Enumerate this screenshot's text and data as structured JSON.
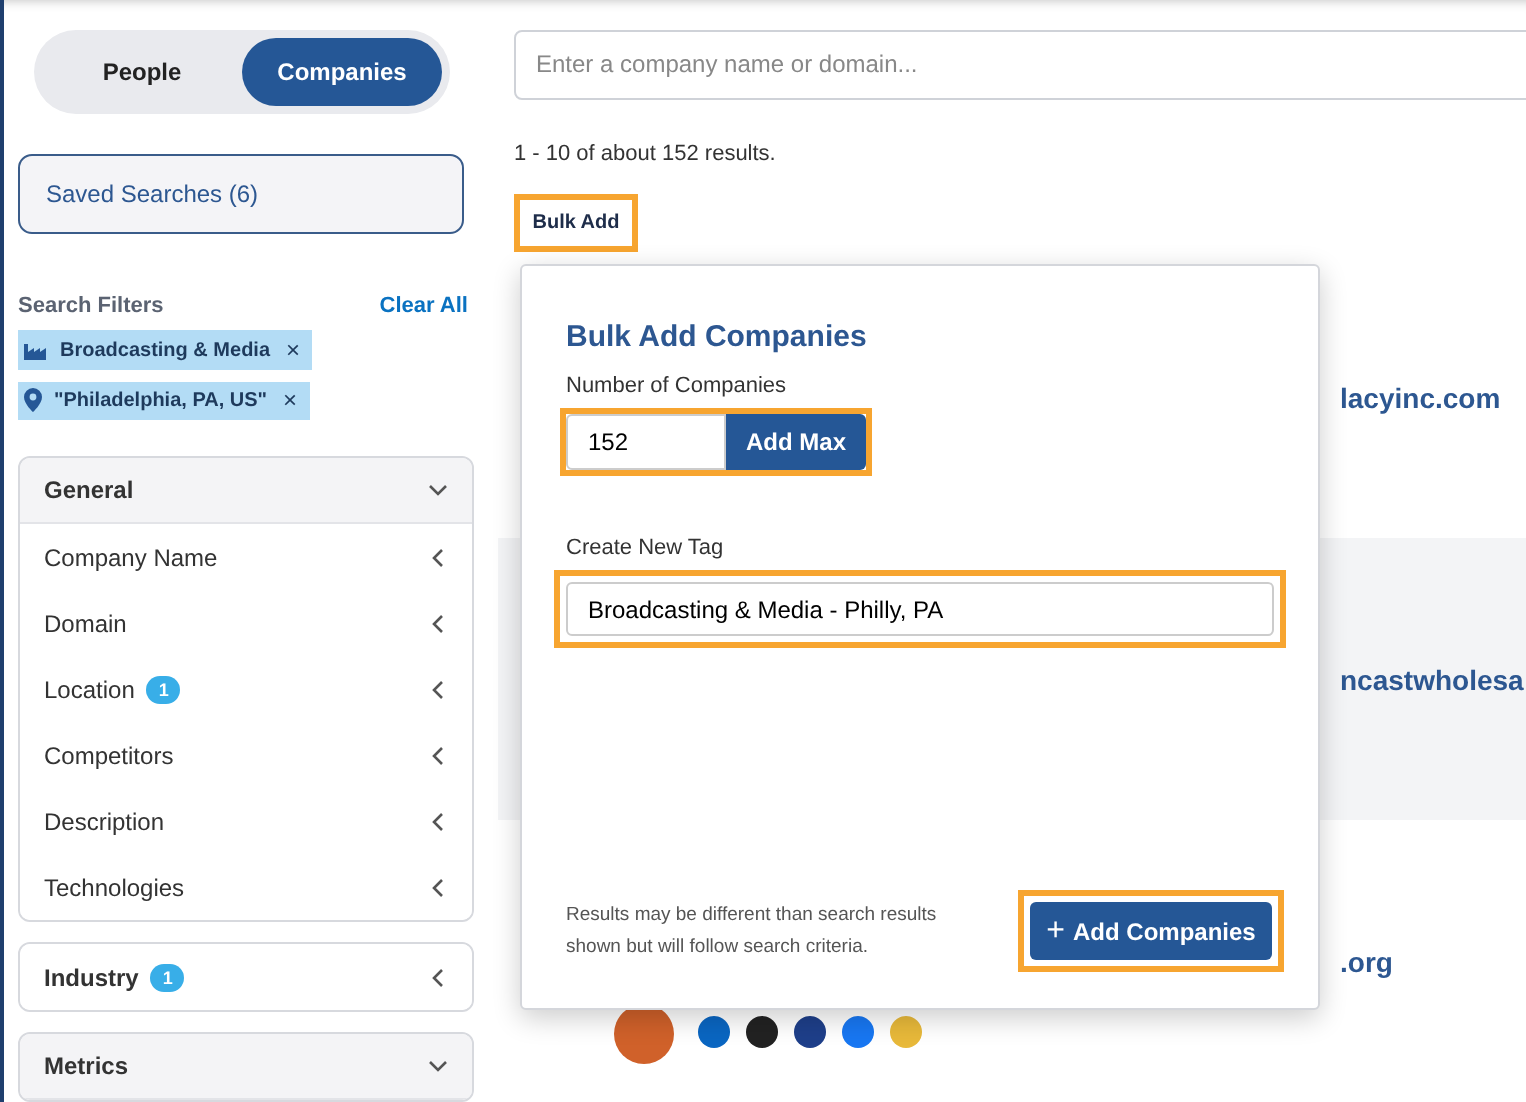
{
  "mode_toggle": [
    {
      "label": "People",
      "selected": false
    },
    {
      "label": "Companies",
      "selected": true
    }
  ],
  "saved_searches": "Saved Searches (6)",
  "filters": {
    "title": "Search Filters",
    "clear": "Clear All",
    "chips": [
      {
        "kind": "industry",
        "label": "Broadcasting & Media",
        "remove": "×"
      },
      {
        "kind": "location",
        "label": "\"Philadelphia, PA, US\"",
        "remove": "×"
      }
    ]
  },
  "sections": [
    {
      "title": "General",
      "expanded": true,
      "items": [
        {
          "label": "Company Name"
        },
        {
          "label": "Domain"
        },
        {
          "label": "Location",
          "count": "1"
        },
        {
          "label": "Competitors"
        },
        {
          "label": "Description"
        },
        {
          "label": "Technologies"
        }
      ]
    },
    {
      "title": "Industry",
      "count": "1",
      "expanded": false
    },
    {
      "title": "Metrics",
      "expanded": true
    }
  ],
  "search": {
    "placeholder": "Enter a company name or domain..."
  },
  "results_summary": "1 - 10 of about 152 results.",
  "bulk_add_button": "Bulk Add",
  "results": [
    {
      "domain": "lacyinc.com",
      "shaded": false
    },
    {
      "domain": "ncastwholesa",
      "shaded": true
    },
    {
      "domain": ".org",
      "shaded": false,
      "socials": true
    }
  ],
  "dialog": {
    "title": "Bulk Add Companies",
    "count_label": "Number of Companies",
    "count_value": "152",
    "max_button": "Add Max",
    "tag_label": "Create New Tag",
    "tag_value": "Broadcasting & Media - Philly, PA",
    "note": "Results may be different than search results shown but will follow search criteria.",
    "submit_icon": "+",
    "submit": "Add Companies"
  }
}
